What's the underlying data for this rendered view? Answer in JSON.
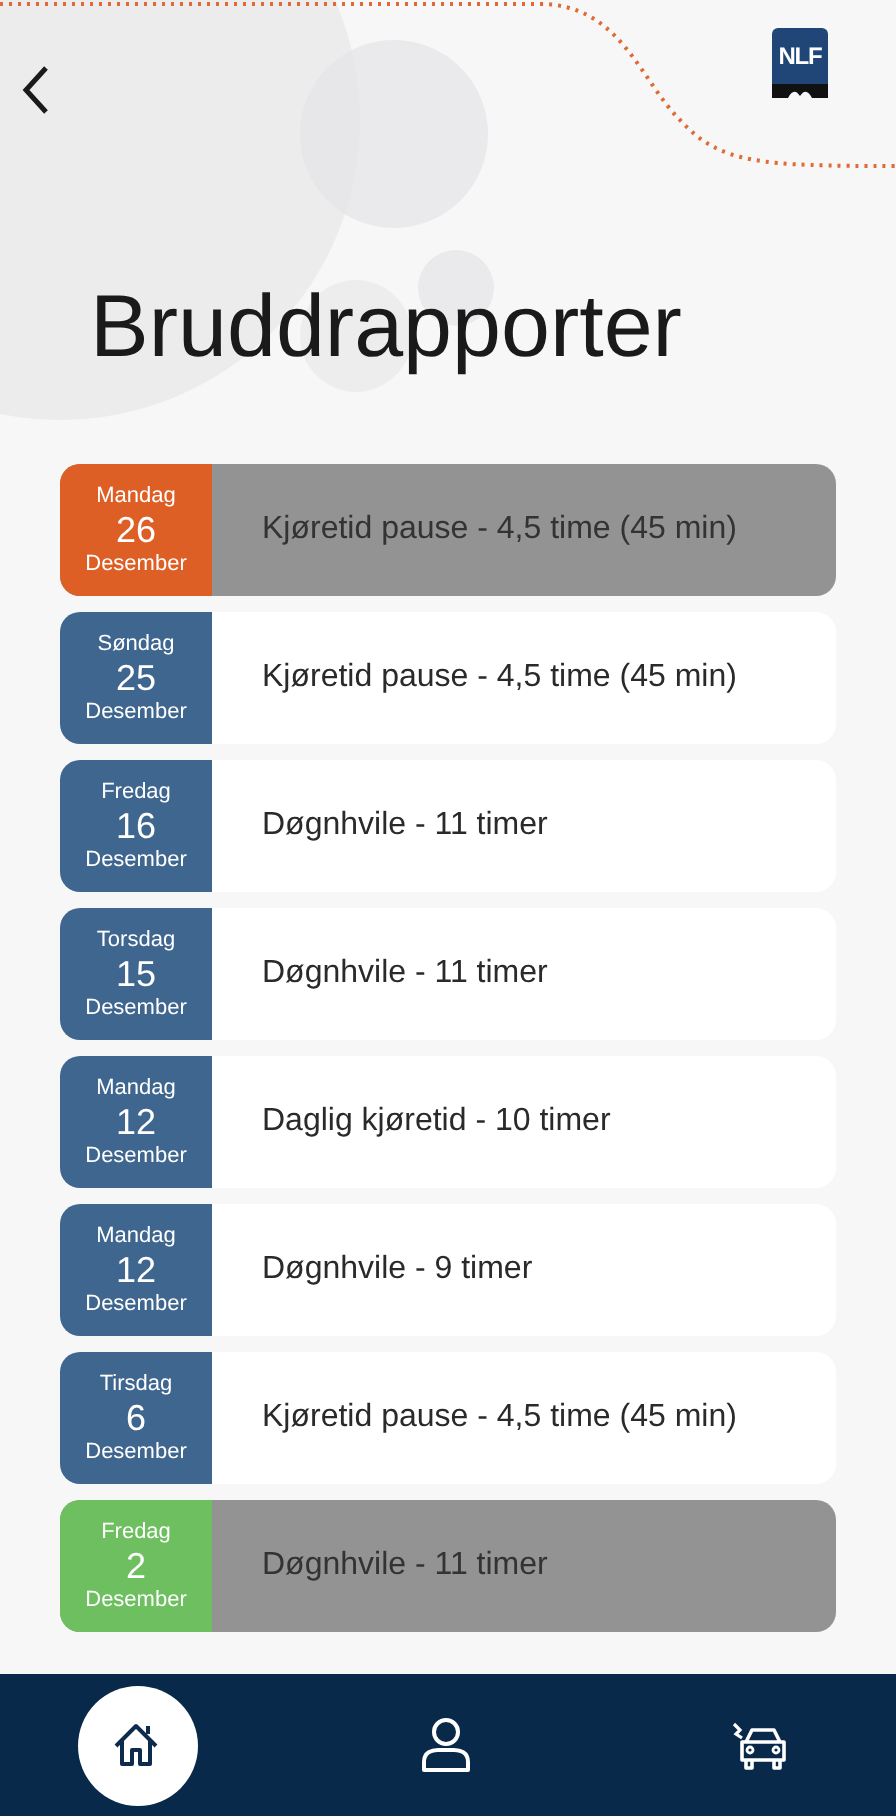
{
  "header": {
    "logo": "NLF",
    "title": "Bruddrapporter"
  },
  "reports": [
    {
      "weekday": "Mandag",
      "day": "26",
      "month": "Desember",
      "text": "Kjøretid pause - 4,5 time (45 min)",
      "color": "#dd5f26",
      "dimmed": true
    },
    {
      "weekday": "Søndag",
      "day": "25",
      "month": "Desember",
      "text": "Kjøretid pause - 4,5 time (45 min)",
      "color": "#3f668e",
      "dimmed": false
    },
    {
      "weekday": "Fredag",
      "day": "16",
      "month": "Desember",
      "text": "Døgnhvile - 11 timer",
      "color": "#3f668e",
      "dimmed": false
    },
    {
      "weekday": "Torsdag",
      "day": "15",
      "month": "Desember",
      "text": "Døgnhvile - 11 timer",
      "color": "#3f668e",
      "dimmed": false
    },
    {
      "weekday": "Mandag",
      "day": "12",
      "month": "Desember",
      "text": "Daglig kjøretid - 10 timer",
      "color": "#3f668e",
      "dimmed": false
    },
    {
      "weekday": "Mandag",
      "day": "12",
      "month": "Desember",
      "text": "Døgnhvile - 9 timer",
      "color": "#3f668e",
      "dimmed": false
    },
    {
      "weekday": "Tirsdag",
      "day": "6",
      "month": "Desember",
      "text": "Kjøretid pause - 4,5 time (45 min)",
      "color": "#3f668e",
      "dimmed": false
    },
    {
      "weekday": "Fredag",
      "day": "2",
      "month": "Desember",
      "text": "Døgnhvile - 11 timer",
      "color": "#6dbf5f",
      "dimmed": true
    }
  ],
  "nav": [
    {
      "kind": "home",
      "selected": true
    },
    {
      "kind": "profile",
      "selected": false
    },
    {
      "kind": "crash",
      "selected": false
    }
  ]
}
